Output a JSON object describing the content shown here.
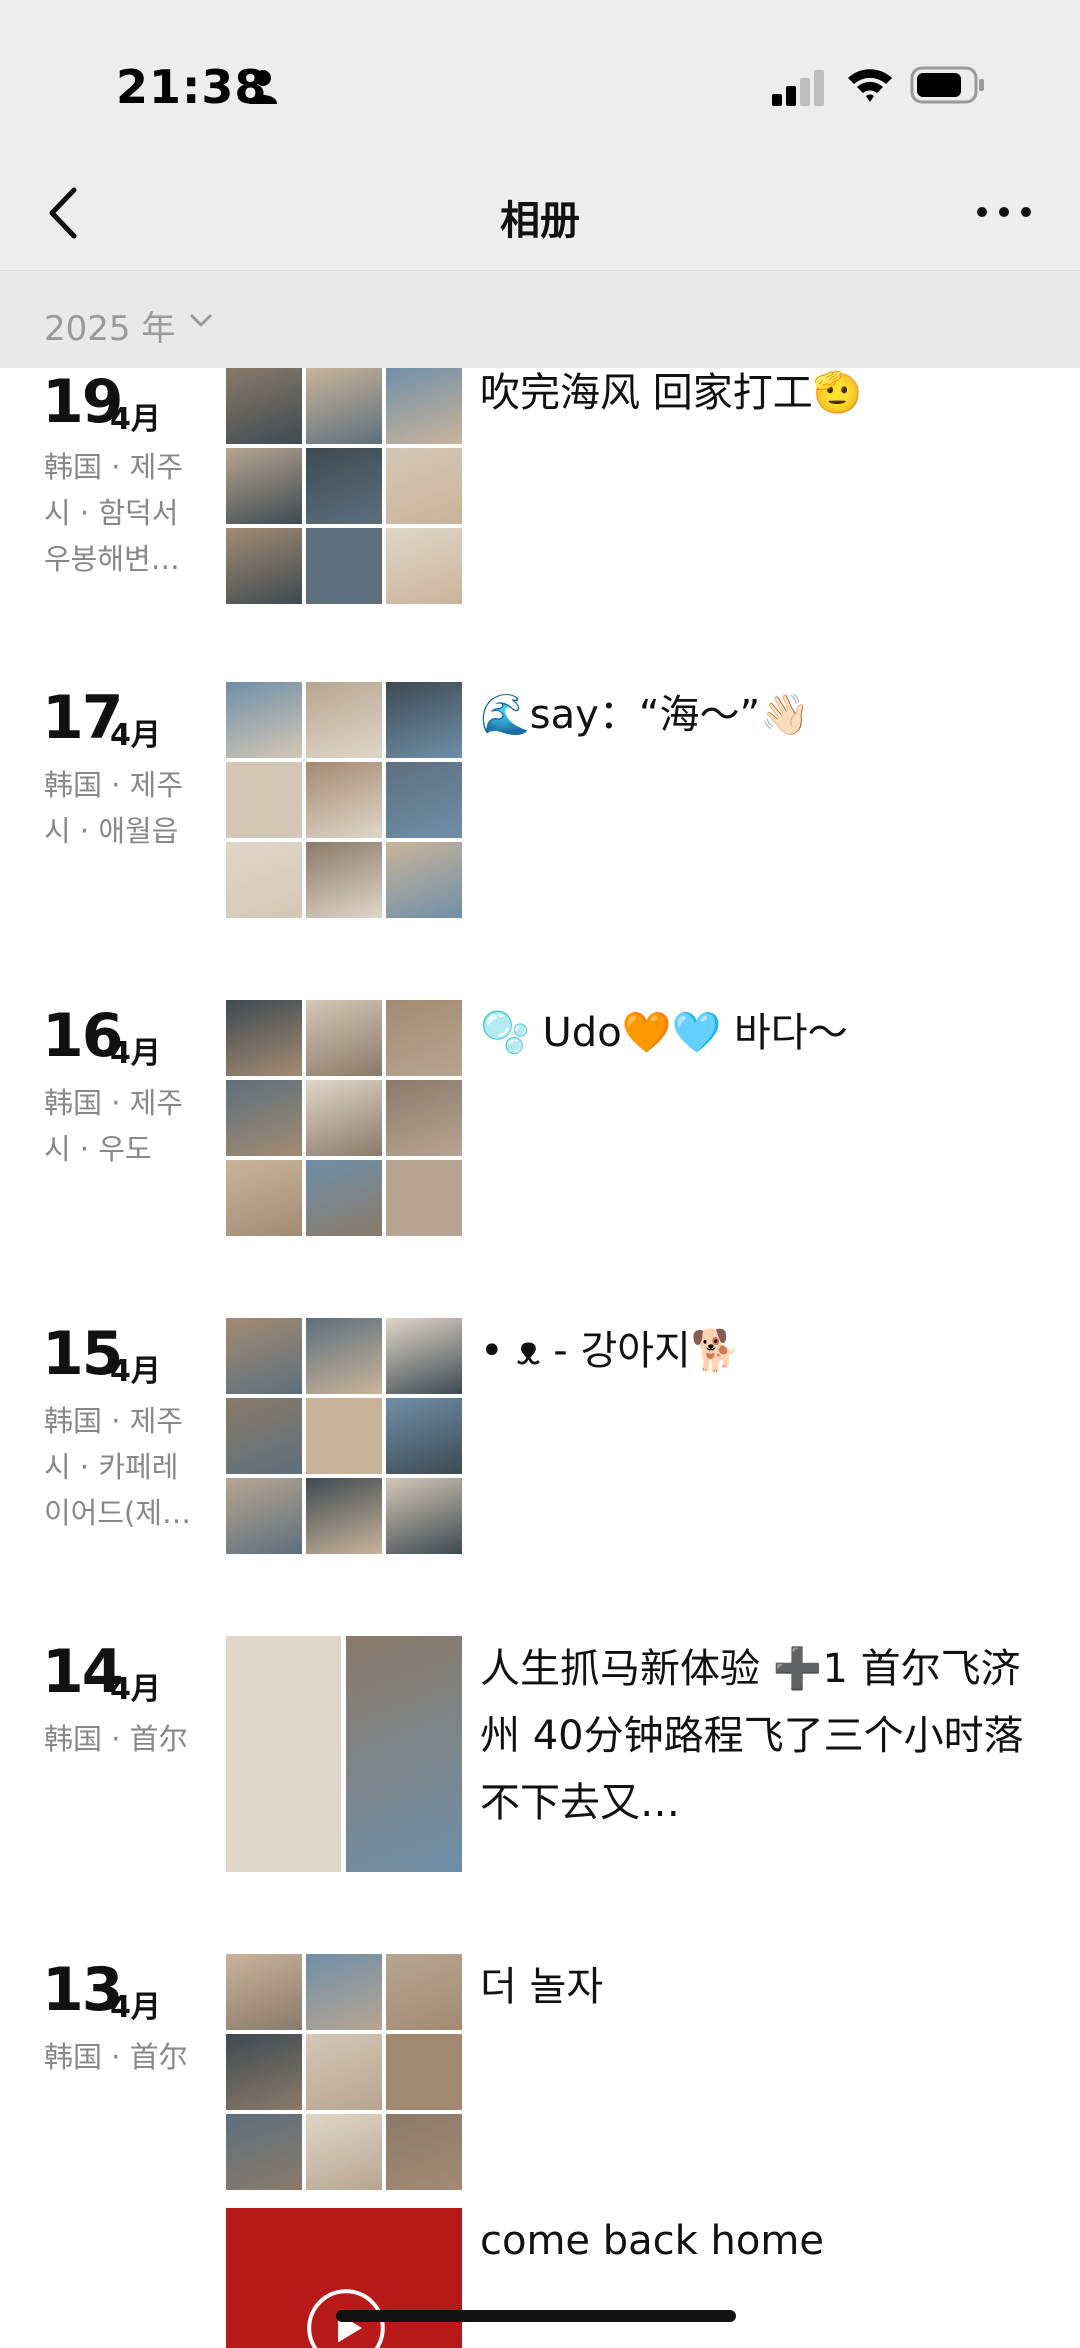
{
  "status": {
    "time": "21:38"
  },
  "nav": {
    "title": "相册"
  },
  "year_filter": {
    "label": "2025 年"
  },
  "colors": {
    "bar_bg": "#ededed",
    "muted_text": "#888888",
    "thumb_palette": [
      "#8a7a6a",
      "#c9b49a",
      "#6f8fa8",
      "#b7a591",
      "#3e4a52",
      "#d4c7b6",
      "#a38b72",
      "#5d6f7d",
      "#e0d6c9"
    ]
  },
  "entries": [
    {
      "day": "19",
      "month": "4月",
      "location": "韩国 · 제주시 · 함덕서우봉해변…",
      "caption": "吹完海风 回家打工🫡",
      "thumb_count": 9
    },
    {
      "day": "17",
      "month": "4月",
      "location": "韩国 · 제주시 · 애월읍",
      "caption": "🌊say：“海～”👋🏻",
      "thumb_count": 9
    },
    {
      "day": "16",
      "month": "4月",
      "location": "韩国 · 제주시 · 우도",
      "caption": "🫧 Udo🧡🩵 바다～",
      "thumb_count": 9
    },
    {
      "day": "15",
      "month": "4月",
      "location": "韩国 · 제주시 · 카페레이어드(제…",
      "caption": "• ᴥ - 강아지🐕",
      "thumb_count": 9
    },
    {
      "day": "14",
      "month": "4月",
      "location": "韩国 · 首尔",
      "caption": "人生抓马新体验 ➕1 首尔飞济州 40分钟路程飞了三个小时落不下去又…",
      "thumb_count": 2
    },
    {
      "day": "13",
      "month": "4月",
      "location": "韩国 · 首尔",
      "caption": "더 놀자",
      "thumb_count": 9
    }
  ],
  "partial_entry": {
    "caption": "come back home"
  }
}
